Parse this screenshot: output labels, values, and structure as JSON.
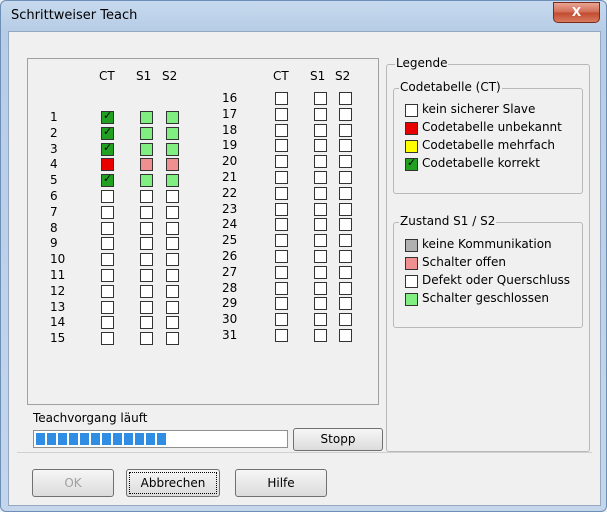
{
  "window": {
    "title": "Schrittweiser Teach",
    "close_label": "X"
  },
  "grid": {
    "headers": {
      "ct": "CT",
      "s1": "S1",
      "s2": "S2"
    },
    "left_rows": [
      {
        "num": "1",
        "ct": "green-check",
        "s1": "lightgreen",
        "s2": "lightgreen"
      },
      {
        "num": "2",
        "ct": "green-check",
        "s1": "lightgreen",
        "s2": "lightgreen"
      },
      {
        "num": "3",
        "ct": "green-check",
        "s1": "lightgreen",
        "s2": "lightgreen"
      },
      {
        "num": "4",
        "ct": "red",
        "s1": "pink",
        "s2": "pink"
      },
      {
        "num": "5",
        "ct": "green-check",
        "s1": "lightgreen",
        "s2": "lightgreen"
      },
      {
        "num": "6",
        "ct": "white",
        "s1": "white",
        "s2": "white"
      },
      {
        "num": "7",
        "ct": "white",
        "s1": "white",
        "s2": "white"
      },
      {
        "num": "8",
        "ct": "white",
        "s1": "white",
        "s2": "white"
      },
      {
        "num": "9",
        "ct": "white",
        "s1": "white",
        "s2": "white"
      },
      {
        "num": "10",
        "ct": "white",
        "s1": "white",
        "s2": "white"
      },
      {
        "num": "11",
        "ct": "white",
        "s1": "white",
        "s2": "white"
      },
      {
        "num": "12",
        "ct": "white",
        "s1": "white",
        "s2": "white"
      },
      {
        "num": "13",
        "ct": "white",
        "s1": "white",
        "s2": "white"
      },
      {
        "num": "14",
        "ct": "white",
        "s1": "white",
        "s2": "white"
      },
      {
        "num": "15",
        "ct": "white",
        "s1": "white",
        "s2": "white"
      }
    ],
    "right_rows": [
      {
        "num": "16",
        "ct": "white",
        "s1": "white",
        "s2": "white"
      },
      {
        "num": "17",
        "ct": "white",
        "s1": "white",
        "s2": "white"
      },
      {
        "num": "18",
        "ct": "white",
        "s1": "white",
        "s2": "white"
      },
      {
        "num": "19",
        "ct": "white",
        "s1": "white",
        "s2": "white"
      },
      {
        "num": "20",
        "ct": "white",
        "s1": "white",
        "s2": "white"
      },
      {
        "num": "21",
        "ct": "white",
        "s1": "white",
        "s2": "white"
      },
      {
        "num": "22",
        "ct": "white",
        "s1": "white",
        "s2": "white"
      },
      {
        "num": "23",
        "ct": "white",
        "s1": "white",
        "s2": "white"
      },
      {
        "num": "24",
        "ct": "white",
        "s1": "white",
        "s2": "white"
      },
      {
        "num": "25",
        "ct": "white",
        "s1": "white",
        "s2": "white"
      },
      {
        "num": "26",
        "ct": "white",
        "s1": "white",
        "s2": "white"
      },
      {
        "num": "27",
        "ct": "white",
        "s1": "white",
        "s2": "white"
      },
      {
        "num": "28",
        "ct": "white",
        "s1": "white",
        "s2": "white"
      },
      {
        "num": "29",
        "ct": "white",
        "s1": "white",
        "s2": "white"
      },
      {
        "num": "30",
        "ct": "white",
        "s1": "white",
        "s2": "white"
      },
      {
        "num": "31",
        "ct": "white",
        "s1": "white",
        "s2": "white"
      }
    ]
  },
  "teach": {
    "status": "Teachvorgang läuft",
    "progress_segments": 12,
    "stop_label": "Stopp"
  },
  "legend": {
    "title": "Legende",
    "codetabelle": {
      "title": "Codetabelle (CT)",
      "items": [
        {
          "color": "white",
          "label": "kein sicherer Slave"
        },
        {
          "color": "red",
          "label": "Codetabelle unbekannt"
        },
        {
          "color": "yellow",
          "label": "Codetabelle mehrfach"
        },
        {
          "color": "green-check",
          "label": "Codetabelle korrekt"
        }
      ]
    },
    "zustand": {
      "title": "Zustand S1 / S2",
      "items": [
        {
          "color": "gray",
          "label": "keine Kommunikation"
        },
        {
          "color": "pink",
          "label": "Schalter offen"
        },
        {
          "color": "white",
          "label": "Defekt oder Querschluss"
        },
        {
          "color": "lightgreen",
          "label": "Schalter geschlossen"
        }
      ]
    }
  },
  "buttons": {
    "ok": "OK",
    "cancel": "Abbrechen",
    "help": "Hilfe"
  },
  "colors": {
    "progress": "#2f8de4",
    "red": "#e80000",
    "green": "#22a022",
    "lightgreen": "#80ee80",
    "pink": "#f08f8f"
  }
}
